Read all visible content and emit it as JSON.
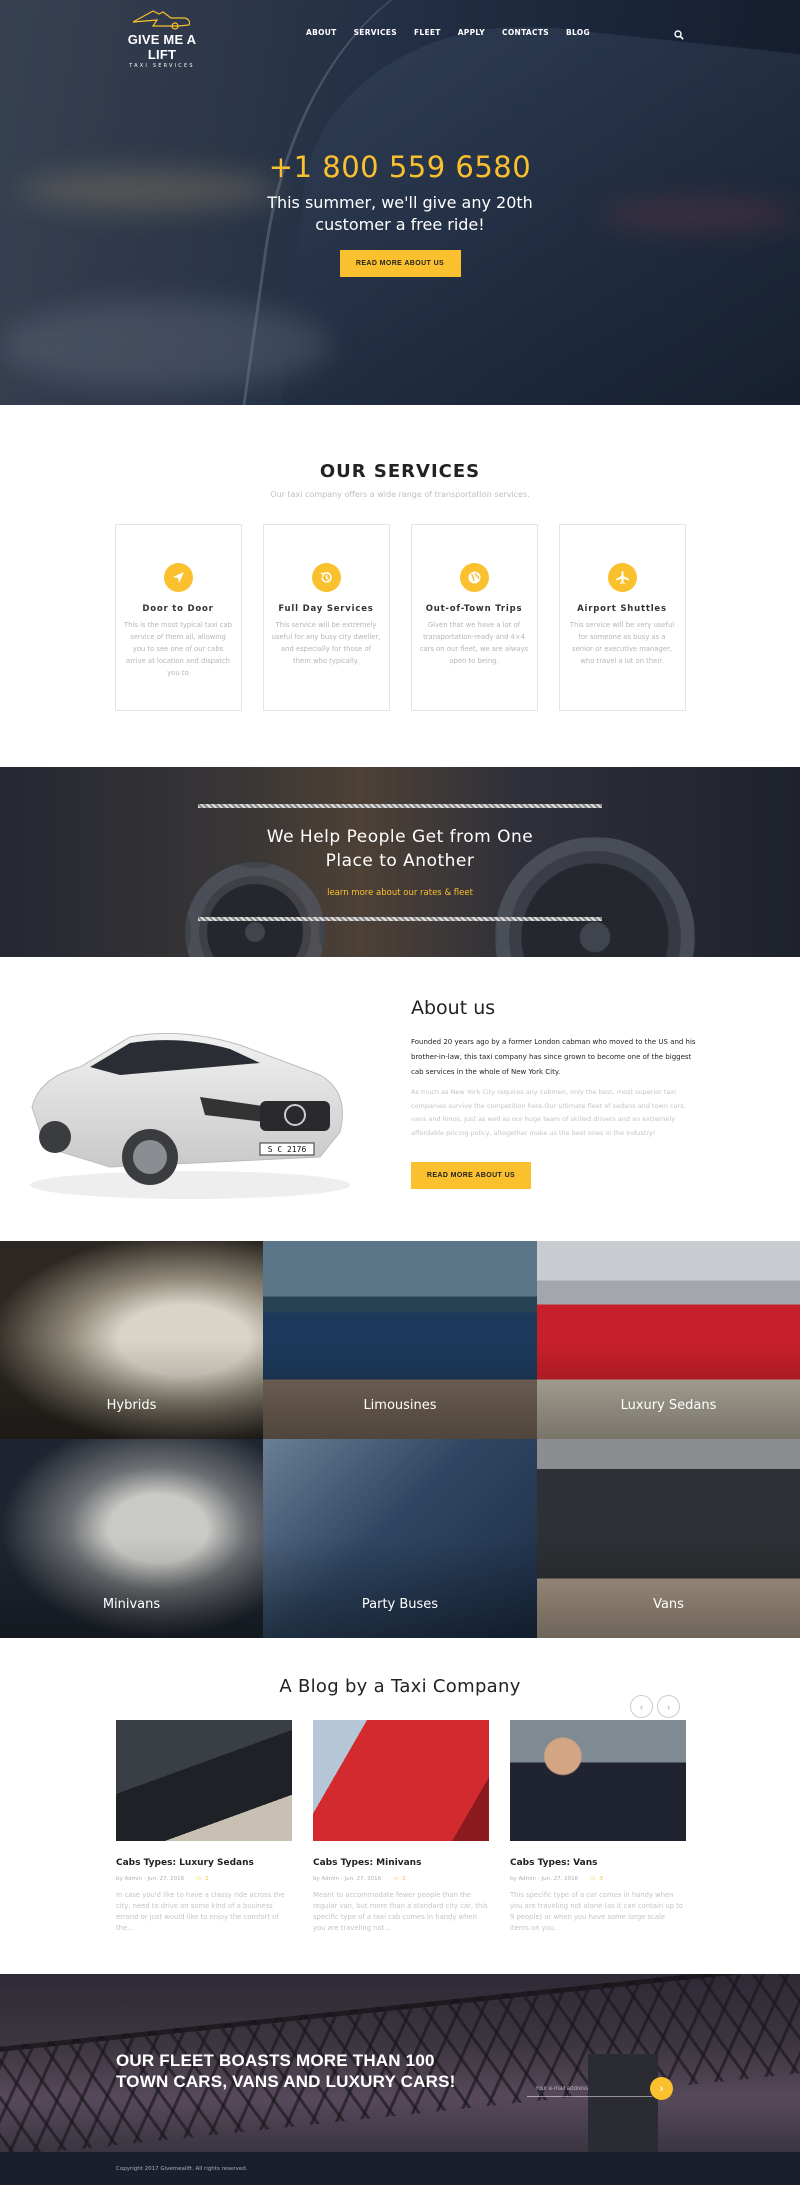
{
  "brand": {
    "name": "GIVE ME A LIFT",
    "tagline": "TAXI SERVICES"
  },
  "nav": {
    "items": [
      "ABOUT",
      "SERVICES",
      "FLEET",
      "APPLY",
      "CONTACTS",
      "BLOG"
    ],
    "search_icon": "search-icon"
  },
  "hero": {
    "phone": "+1 800 559 6580",
    "tagline_line1": "This summer, we'll give any 20th",
    "tagline_line2": "customer a free ride!",
    "button": "READ MORE ABOUT US"
  },
  "services": {
    "title": "OUR SERVICES",
    "subtitle": "Our taxi company offers a wide range of transportation services.",
    "items": [
      {
        "icon": "navigation-arrow-icon",
        "title": "Door to Door",
        "text": "This is the most typical taxi cab service of them all, allowing you to see one of our cabs arrive at location and dispatch you to"
      },
      {
        "icon": "history-clock-icon",
        "title": "Full Day Services",
        "text": "This service will be extremely useful for any busy city dweller, and especially for those of them who typically."
      },
      {
        "icon": "globe-icon",
        "title": "Out-of-Town Trips",
        "text": "Given that we have a lot of transportation-ready and 4×4 cars on our fleet, we are always open to being."
      },
      {
        "icon": "airplane-icon",
        "title": "Airport Shuttles",
        "text": "This service will be very useful for someone as busy as a senior or executive manager, who travel a lot on their."
      }
    ]
  },
  "banner": {
    "line1": "We Help People Get from One",
    "line2": "Place to Another",
    "link": "learn more about our rates & fleet"
  },
  "about": {
    "title": "About us",
    "lead": "Founded 20 years ago by a former London cabman who moved to the US and his brother-in-law, this taxi company has since grown to become one of the biggest cab services in the whole of New York City.",
    "body": "As much as New York City requires any cabmen, only the best, most superior taxi companies survive the competition here.Our ultimate fleet of sedans and town cars, vans and limos, just as well as our huge team of skilled drivers and an extremely affordable pricing policy, altogether make us the best ones in the industry!",
    "button": "READ MORE ABOUT US",
    "plate": "S C 2176"
  },
  "fleet": {
    "items": [
      "Hybrids",
      "Limousines",
      "Luxury Sedans",
      "Minivans",
      "Party Buses",
      "Vans"
    ]
  },
  "blog": {
    "title": "A Blog by a Taxi Company",
    "prev": "‹",
    "next": "›",
    "posts": [
      {
        "title": "Cabs Types: Luxury Sedans",
        "meta": "by Admin - Jun. 27, 2016",
        "comments": "2",
        "excerpt": "In case you'd like to have a classy ride across the city, need to drive on some kind of a business errand or just would like to enjoy the comfort of the..."
      },
      {
        "title": "Cabs Types: Minivans",
        "meta": "by Admin - Jun. 27, 2016",
        "comments": "2",
        "excerpt": "Meant to accommodate fewer people than the regular van, but more than a standard city car, this specific type of a taxi cab comes in handy when you are traveling not..."
      },
      {
        "title": "Cabs Types: Vans",
        "meta": "by Admin - Jun. 27, 2016",
        "comments": "3",
        "excerpt": "This specific type of a car comes in handy when you are traveling not alone (as it can contain up to 9 people) or when you have some large scale items on you."
      }
    ]
  },
  "cta": {
    "line1": "OUR FLEET BOASTS MORE THAN 100",
    "line2": "TOWN CARS, VANS AND LUXURY CARS!",
    "email_placeholder": "Your e-mail address",
    "submit": "›"
  },
  "footer": {
    "copyright": "Copyright 2017 Givemealift. All rights reserved."
  },
  "colors": {
    "accent": "#fbc02d",
    "footer_bg": "#1a202b"
  }
}
